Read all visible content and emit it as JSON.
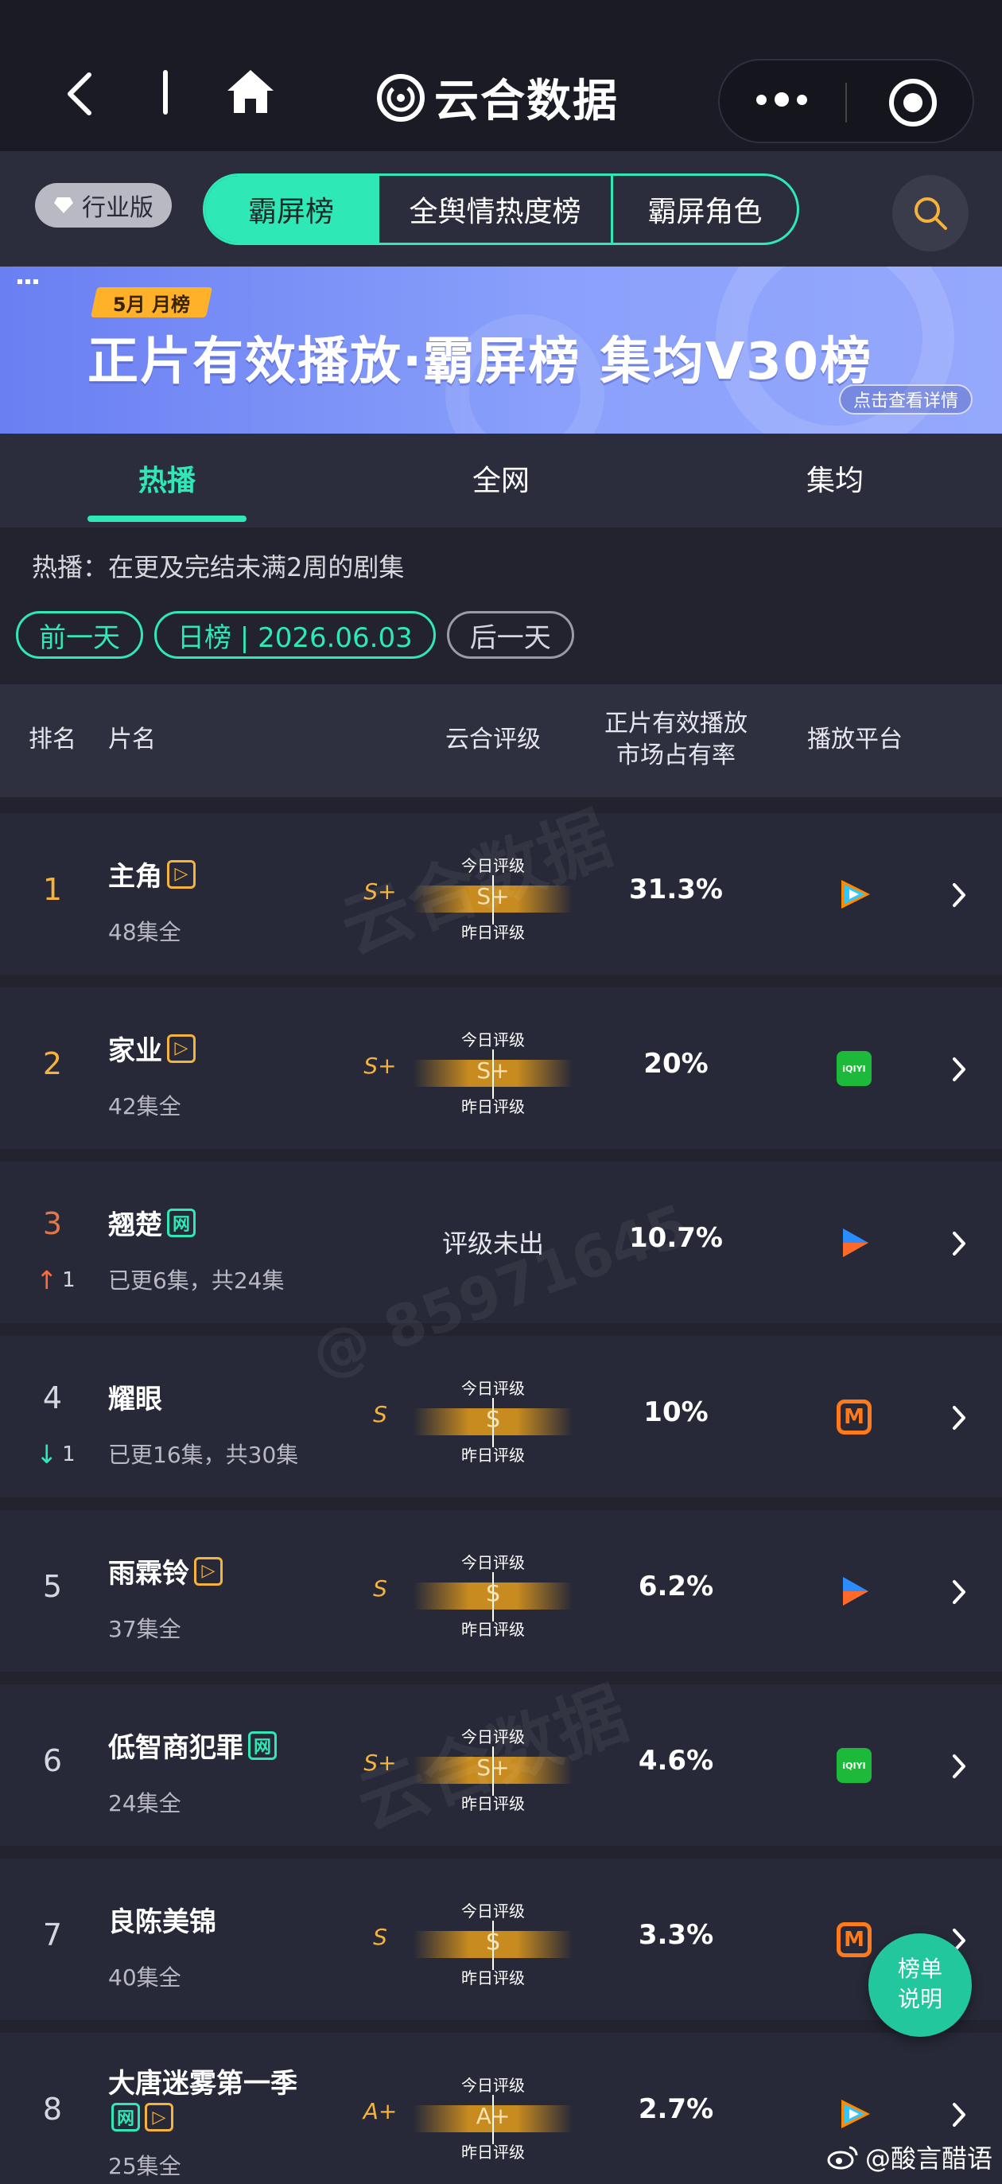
{
  "nav": {
    "brand": "云合数据"
  },
  "top_tabs": {
    "industry_badge": "行业版",
    "tabs": [
      {
        "label": "霸屏榜",
        "active": true
      },
      {
        "label": "全舆情热度榜",
        "active": false
      },
      {
        "label": "霸屏角色",
        "active": false
      }
    ]
  },
  "banner": {
    "month_tag": "5月 月榜",
    "title": "正片有效播放·霸屏榜 集均V30榜",
    "link": "点击查看详情"
  },
  "sub_tabs": [
    {
      "label": "热播",
      "active": true
    },
    {
      "label": "全网",
      "active": false
    },
    {
      "label": "集均",
      "active": false
    }
  ],
  "description": "热播：在更及完结未满2周的剧集",
  "date_controls": {
    "prev": "前一天",
    "current": "日榜 | 2026.06.03",
    "next": "后一天"
  },
  "table": {
    "headers": {
      "rank": "排名",
      "title": "片名",
      "rating": "云合评级",
      "share_line1": "正片有效播放",
      "share_line2": "市场占有率",
      "platform": "播放平台"
    },
    "grade_today_label": "今日评级",
    "grade_yesterday_label": "昨日评级",
    "rows": [
      {
        "rank": "1",
        "title": "主角",
        "tags": [
          "vip"
        ],
        "sub": "48集全",
        "grade": "S+",
        "grade_mid": "S+",
        "share": "31.3%",
        "platform": "tencent-video"
      },
      {
        "rank": "2",
        "title": "家业",
        "tags": [
          "vip"
        ],
        "sub": "42集全",
        "grade": "S+",
        "grade_mid": "S+",
        "share": "20%",
        "platform": "iqiyi"
      },
      {
        "rank": "3",
        "change": "1",
        "change_dir": "up",
        "title": "翘楚",
        "tags": [
          "net"
        ],
        "sub": "已更6集，共24集",
        "grade_none": "评级未出",
        "share": "10.7%",
        "platform": "youku"
      },
      {
        "rank": "4",
        "change": "1",
        "change_dir": "down",
        "title": "耀眼",
        "tags": [],
        "sub": "已更16集，共30集",
        "grade": "S",
        "grade_mid": "S",
        "share": "10%",
        "platform": "mango-tv"
      },
      {
        "rank": "5",
        "title": "雨霖铃",
        "tags": [
          "vip"
        ],
        "sub": "37集全",
        "grade": "S",
        "grade_mid": "S",
        "share": "6.2%",
        "platform": "youku"
      },
      {
        "rank": "6",
        "title": "低智商犯罪",
        "tags": [
          "net"
        ],
        "sub": "24集全",
        "grade": "S+",
        "grade_mid": "S+",
        "share": "4.6%",
        "platform": "iqiyi"
      },
      {
        "rank": "7",
        "title": "良陈美锦",
        "tags": [],
        "sub": "40集全",
        "grade": "S",
        "grade_mid": "S",
        "share": "3.3%",
        "platform": "mango-tv"
      },
      {
        "rank": "8",
        "title": "大唐迷雾第一季",
        "tags": [
          "net",
          "vip"
        ],
        "sub": "25集全",
        "grade": "A+",
        "grade_mid": "A+",
        "share": "2.7%",
        "platform": "tencent-video"
      }
    ],
    "tag_labels": {
      "net": "网",
      "vip": "▷"
    },
    "iqiyi_text": "iQIYI",
    "mango_text": "M"
  },
  "help_button": {
    "line1": "榜单",
    "line2": "说明"
  },
  "watermark_text": "@酸言醋语",
  "watermarks": {
    "brand": "云合数据",
    "number": "@ 85971645"
  },
  "colors": {
    "accent": "#2ee8b6",
    "gold": "#f5b23c",
    "bg": "#22232f"
  }
}
